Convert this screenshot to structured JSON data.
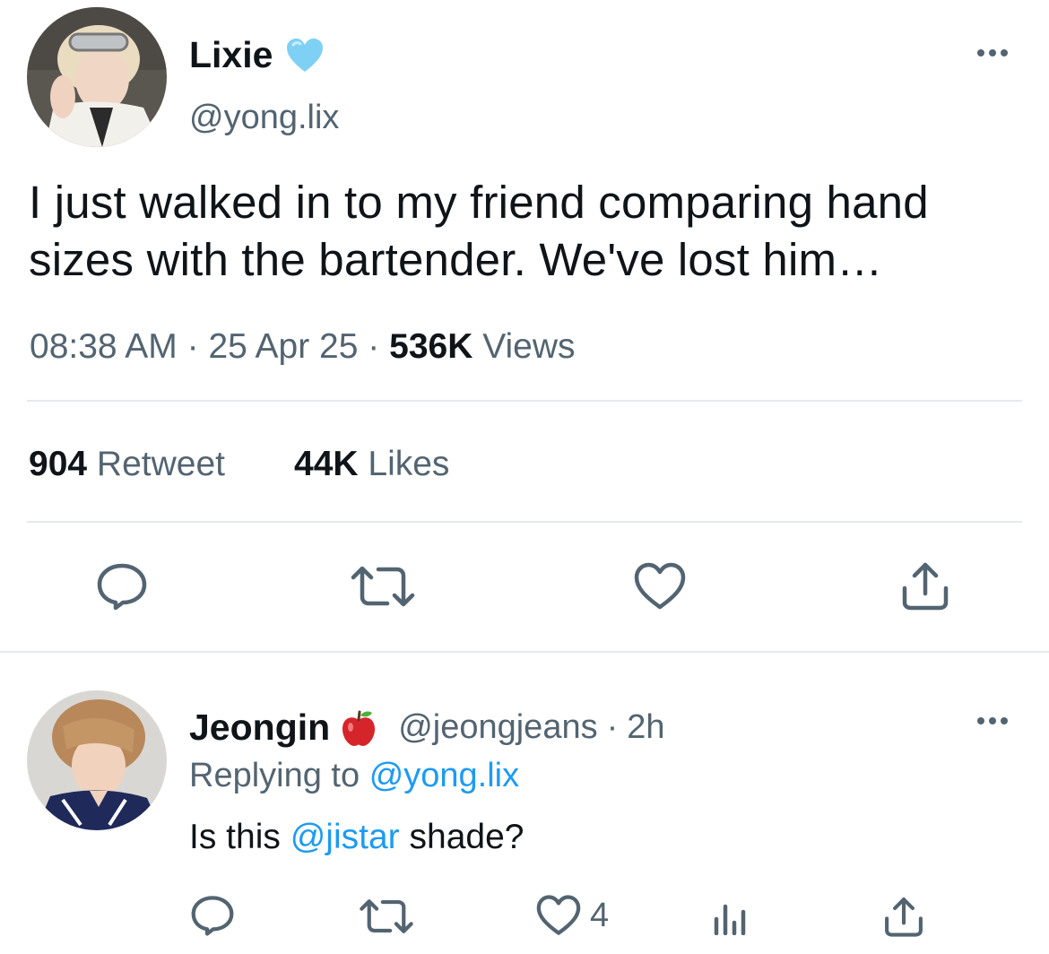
{
  "tweet": {
    "author_name": "Lixie",
    "verified_badge": "light-blue-heart-emoji",
    "author_handle": "@yong.lix",
    "text_line1": "I just walked in to my friend comparing hand",
    "text_line2": "sizes with the bartender. We've lost him…",
    "time": "08:38 AM",
    "sep1": "·",
    "date": "25 Apr 25",
    "sep2": "·",
    "views_count": "536K",
    "views_label": "Views",
    "retweet_count": "904",
    "retweet_label": "Retweet",
    "likes_count": "44K",
    "likes_label": "Likes",
    "actions": [
      "reply-icon",
      "retweet-icon",
      "like-icon",
      "share-icon"
    ]
  },
  "reply": {
    "author_name": "Jeongin",
    "badge": "red-apple-emoji",
    "author_handle": "@jeongjeans",
    "sep": "·",
    "time_ago": "2h",
    "replying_prefix": "Replying to",
    "replying_to": "@yong.lix",
    "text_before": "Is this",
    "mention": "@jistar",
    "text_after": "shade?",
    "like_count": "4",
    "actions": [
      "reply-icon",
      "retweet-icon",
      "like-icon",
      "analytics-icon",
      "share-icon"
    ]
  },
  "colors": {
    "text": "#0f1419",
    "secondary": "#536471",
    "link": "#1d9bf0",
    "divider": "#e6e9ec",
    "heart_badge": "#7fd0f5"
  }
}
